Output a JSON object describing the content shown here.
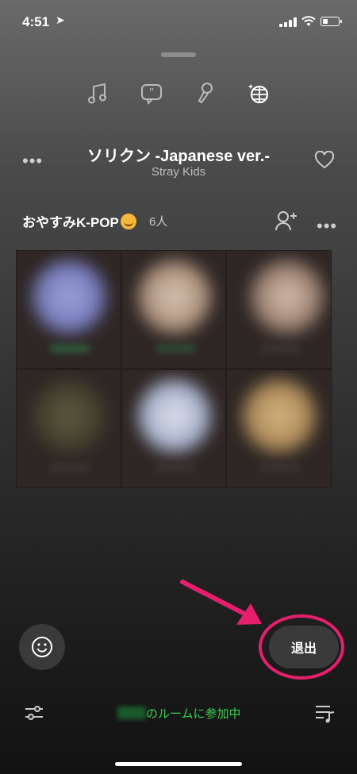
{
  "status_bar": {
    "time": "4:51"
  },
  "tabs": [
    {
      "name": "music-note-icon"
    },
    {
      "name": "chat-bubble-icon"
    },
    {
      "name": "microphone-icon"
    },
    {
      "name": "disco-ball-icon"
    }
  ],
  "track": {
    "title": "ソリクン -Japanese ver.-",
    "artist": "Stray Kids",
    "more": "•••"
  },
  "room": {
    "name": "おやすみK-POP",
    "member_count": "6人",
    "more": "•••"
  },
  "actions": {
    "exit_label": "退出"
  },
  "footer": {
    "joined_text": "のルームに参加中"
  },
  "colors": {
    "accent_pink": "#e51f6d",
    "joined_green": "#3bd34f"
  }
}
